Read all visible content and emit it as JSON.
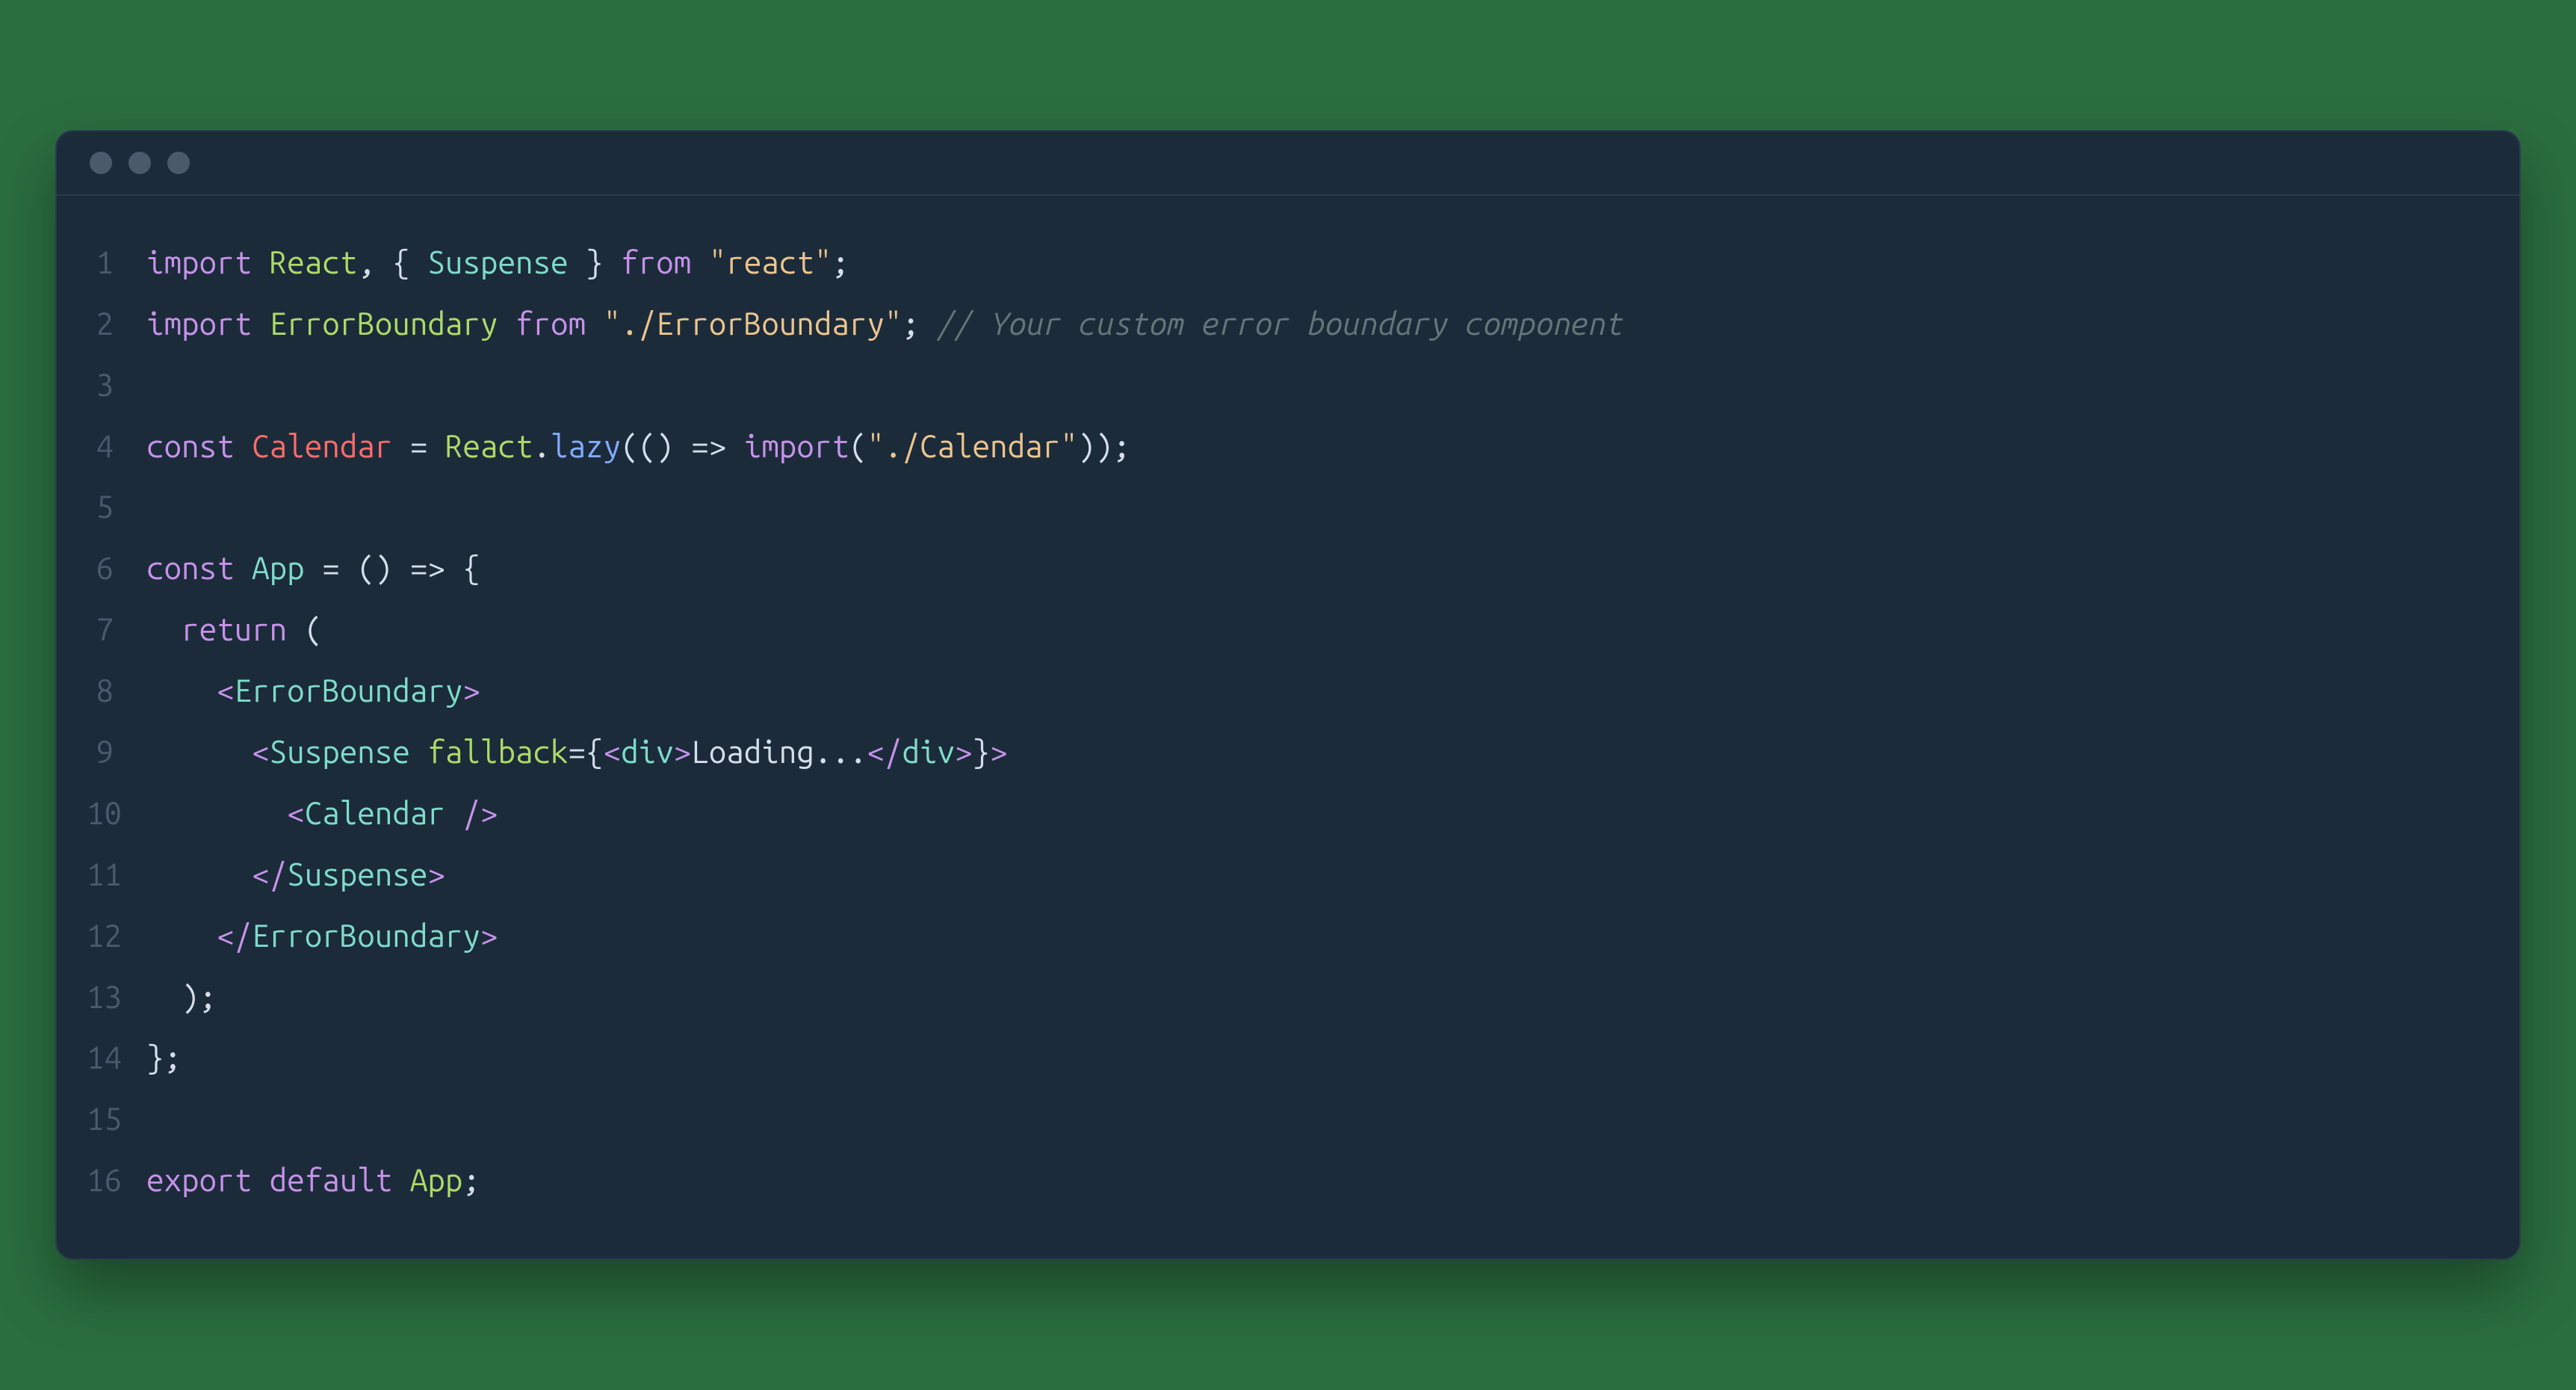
{
  "code": {
    "lines": [
      {
        "n": "1",
        "tokens": [
          {
            "c": "kw",
            "t": "import"
          },
          {
            "c": "punct",
            "t": " "
          },
          {
            "c": "class",
            "t": "React"
          },
          {
            "c": "punct",
            "t": ", { "
          },
          {
            "c": "type",
            "t": "Suspense"
          },
          {
            "c": "punct",
            "t": " } "
          },
          {
            "c": "kw",
            "t": "from"
          },
          {
            "c": "punct",
            "t": " "
          },
          {
            "c": "str",
            "t": "\"react\""
          },
          {
            "c": "punct",
            "t": ";"
          }
        ]
      },
      {
        "n": "2",
        "tokens": [
          {
            "c": "kw",
            "t": "import"
          },
          {
            "c": "punct",
            "t": " "
          },
          {
            "c": "class",
            "t": "ErrorBoundary"
          },
          {
            "c": "punct",
            "t": " "
          },
          {
            "c": "kw",
            "t": "from"
          },
          {
            "c": "punct",
            "t": " "
          },
          {
            "c": "str",
            "t": "\"./ErrorBoundary\""
          },
          {
            "c": "punct",
            "t": "; "
          },
          {
            "c": "comment",
            "t": "// Your custom error boundary component"
          }
        ]
      },
      {
        "n": "3",
        "tokens": [
          {
            "c": "punct",
            "t": ""
          }
        ]
      },
      {
        "n": "4",
        "tokens": [
          {
            "c": "kw",
            "t": "const"
          },
          {
            "c": "punct",
            "t": " "
          },
          {
            "c": "const",
            "t": "Calendar"
          },
          {
            "c": "punct",
            "t": " = "
          },
          {
            "c": "class",
            "t": "React"
          },
          {
            "c": "punct",
            "t": "."
          },
          {
            "c": "member",
            "t": "lazy"
          },
          {
            "c": "punct",
            "t": "(() => "
          },
          {
            "c": "kw",
            "t": "import"
          },
          {
            "c": "punct",
            "t": "("
          },
          {
            "c": "str",
            "t": "\"./Calendar\""
          },
          {
            "c": "punct",
            "t": "));"
          }
        ]
      },
      {
        "n": "5",
        "tokens": [
          {
            "c": "punct",
            "t": ""
          }
        ]
      },
      {
        "n": "6",
        "tokens": [
          {
            "c": "kw",
            "t": "const"
          },
          {
            "c": "punct",
            "t": " "
          },
          {
            "c": "type",
            "t": "App"
          },
          {
            "c": "punct",
            "t": " = () => {"
          }
        ]
      },
      {
        "n": "7",
        "tokens": [
          {
            "c": "punct",
            "t": "  "
          },
          {
            "c": "kw",
            "t": "return"
          },
          {
            "c": "punct",
            "t": " ("
          }
        ]
      },
      {
        "n": "8",
        "tokens": [
          {
            "c": "punct",
            "t": "    "
          },
          {
            "c": "tagpunct",
            "t": "<"
          },
          {
            "c": "tag",
            "t": "ErrorBoundary"
          },
          {
            "c": "tagpunct",
            "t": ">"
          }
        ]
      },
      {
        "n": "9",
        "tokens": [
          {
            "c": "punct",
            "t": "      "
          },
          {
            "c": "tagpunct",
            "t": "<"
          },
          {
            "c": "tag",
            "t": "Suspense"
          },
          {
            "c": "punct",
            "t": " "
          },
          {
            "c": "attr",
            "t": "fallback"
          },
          {
            "c": "punct",
            "t": "={"
          },
          {
            "c": "tagpunct",
            "t": "<"
          },
          {
            "c": "tag",
            "t": "div"
          },
          {
            "c": "tagpunct",
            "t": ">"
          },
          {
            "c": "text",
            "t": "Loading..."
          },
          {
            "c": "tagpunct",
            "t": "</"
          },
          {
            "c": "tag",
            "t": "div"
          },
          {
            "c": "tagpunct",
            "t": ">"
          },
          {
            "c": "punct",
            "t": "}"
          },
          {
            "c": "tagpunct",
            "t": ">"
          }
        ]
      },
      {
        "n": "10",
        "tokens": [
          {
            "c": "punct",
            "t": "        "
          },
          {
            "c": "tagpunct",
            "t": "<"
          },
          {
            "c": "tag",
            "t": "Calendar"
          },
          {
            "c": "punct",
            "t": " "
          },
          {
            "c": "tagpunct",
            "t": "/>"
          }
        ]
      },
      {
        "n": "11",
        "tokens": [
          {
            "c": "punct",
            "t": "      "
          },
          {
            "c": "tagpunct",
            "t": "</"
          },
          {
            "c": "tag",
            "t": "Suspense"
          },
          {
            "c": "tagpunct",
            "t": ">"
          }
        ]
      },
      {
        "n": "12",
        "tokens": [
          {
            "c": "punct",
            "t": "    "
          },
          {
            "c": "tagpunct",
            "t": "</"
          },
          {
            "c": "tag",
            "t": "ErrorBoundary"
          },
          {
            "c": "tagpunct",
            "t": ">"
          }
        ]
      },
      {
        "n": "13",
        "tokens": [
          {
            "c": "punct",
            "t": "  );"
          }
        ]
      },
      {
        "n": "14",
        "tokens": [
          {
            "c": "punct",
            "t": "};"
          }
        ]
      },
      {
        "n": "15",
        "tokens": [
          {
            "c": "punct",
            "t": ""
          }
        ]
      },
      {
        "n": "16",
        "tokens": [
          {
            "c": "kw",
            "t": "export"
          },
          {
            "c": "punct",
            "t": " "
          },
          {
            "c": "kw",
            "t": "default"
          },
          {
            "c": "punct",
            "t": " "
          },
          {
            "c": "class",
            "t": "App"
          },
          {
            "c": "punct",
            "t": ";"
          }
        ]
      }
    ]
  }
}
